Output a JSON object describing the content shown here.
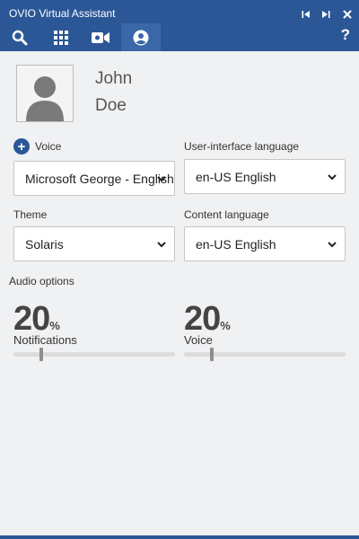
{
  "app": {
    "title": "OVIO Virtual Assistant"
  },
  "window_controls": [
    {
      "name": "first-icon"
    },
    {
      "name": "last-icon"
    },
    {
      "name": "close-icon"
    }
  ],
  "tabs": [
    {
      "name": "search-icon",
      "active": false
    },
    {
      "name": "grid-icon",
      "active": false
    },
    {
      "name": "video-camera-icon",
      "active": false
    },
    {
      "name": "user-icon",
      "active": true
    }
  ],
  "help": {
    "label": "?"
  },
  "user": {
    "first_name": "John",
    "last_name": "Doe",
    "avatar_icon": "avatar-icon"
  },
  "voice": {
    "add_icon": "+",
    "label": "Voice",
    "selected": "Microsoft George - English (United Kingdom)"
  },
  "ui_language": {
    "label": "User-interface language",
    "selected": "en-US English"
  },
  "theme": {
    "label": "Theme",
    "selected": "Solaris"
  },
  "content_language": {
    "label": "Content language",
    "selected": "en-US English"
  },
  "audio": {
    "label": "Audio options",
    "notifications": {
      "value": "20",
      "unit": "%",
      "label": "Notifications",
      "level": 0.2
    },
    "voice": {
      "value": "20",
      "unit": "%",
      "label": "Voice",
      "level": 0.2
    }
  },
  "colors": {
    "brand": "#2b5797",
    "background": "#f0f1f3"
  }
}
